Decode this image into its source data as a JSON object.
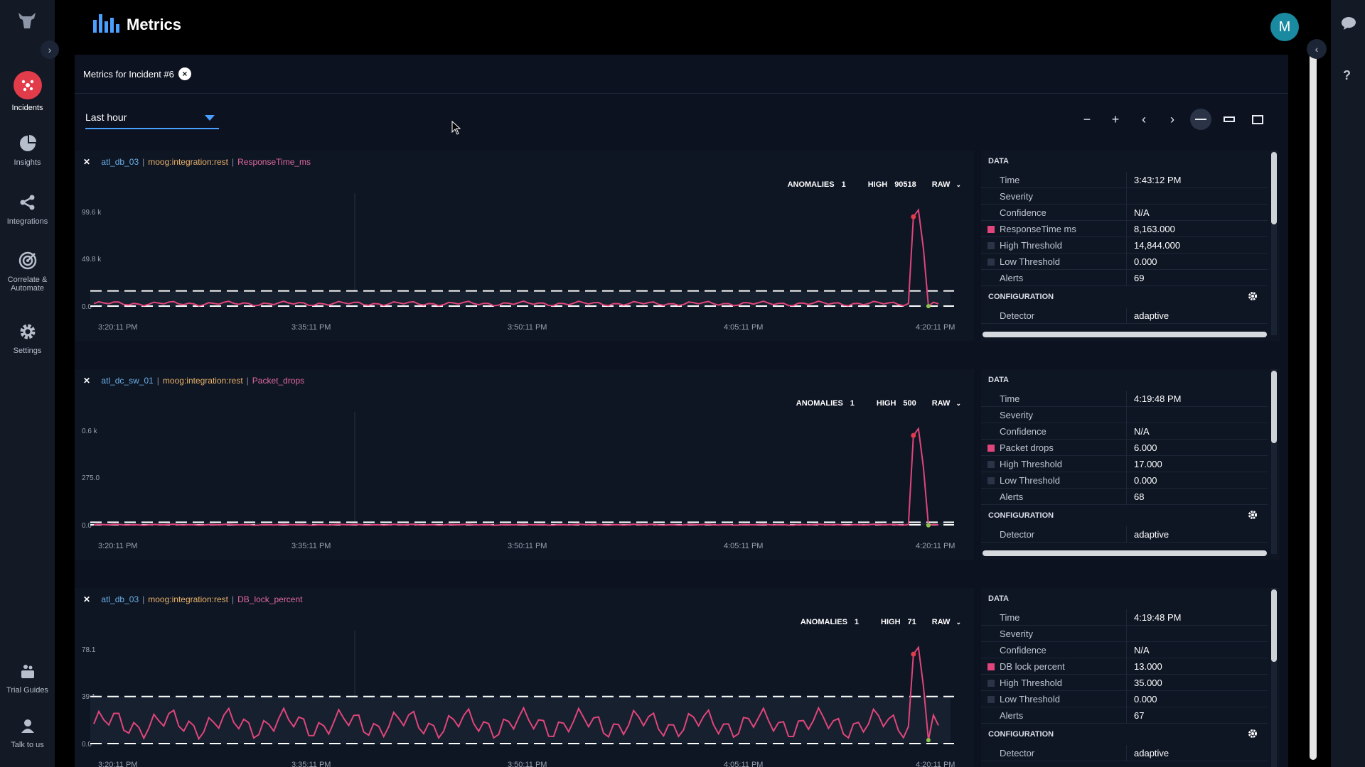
{
  "header": {
    "title": "Metrics"
  },
  "user": {
    "initial": "M"
  },
  "nav": {
    "items": [
      {
        "label": "Incidents",
        "icon": "incidents-icon"
      },
      {
        "label": "Insights",
        "icon": "insights-icon"
      },
      {
        "label": "Integrations",
        "icon": "integrations-icon"
      },
      {
        "label": "Correlate &",
        "label2": "Automate",
        "icon": "correlate-icon"
      },
      {
        "label": "Settings",
        "icon": "gear-icon"
      },
      {
        "label": "Trial Guides",
        "icon": "trial-guides-icon"
      },
      {
        "label": "Talk to us",
        "icon": "talk-icon"
      }
    ]
  },
  "panel": {
    "title": "Metrics for Incident #6",
    "time_range": "Last hour"
  },
  "toolbar": {
    "zoom_out": "−",
    "zoom_in": "+",
    "prev": "‹",
    "next": "›"
  },
  "help": "?",
  "metrics": [
    {
      "source": "atl_db_03",
      "integration": "moog:integration:rest",
      "metric": "ResponseTime_ms",
      "anomalies_label": "ANOMALIES",
      "anomalies": "1",
      "high_label": "HIGH",
      "high": "90518",
      "mode": "RAW",
      "y_ticks": [
        "99.6 k",
        "49.8 k",
        "0.0"
      ],
      "x_ticks": [
        "3:20:11 PM",
        "3:35:11 PM",
        "3:50:11 PM",
        "4:05:11 PM",
        "4:20:11 PM"
      ],
      "chart_data": {
        "type": "line",
        "ylim": [
          0,
          99600
        ],
        "high_threshold": 14844,
        "low_threshold": 0,
        "baseline": 3000,
        "noise": 2500,
        "spike_peak": 90518,
        "spike_start": 3000
      },
      "data": {
        "section": "DATA",
        "rows": [
          {
            "k": "Time",
            "v": "3:43:12 PM",
            "sw": "none"
          },
          {
            "k": "Severity",
            "v": "",
            "sw": "none"
          },
          {
            "k": "Confidence",
            "v": "N/A",
            "sw": "none"
          },
          {
            "k": "ResponseTime ms",
            "v": "8,163.000",
            "sw": "pink"
          },
          {
            "k": "High Threshold",
            "v": "14,844.000",
            "sw": "dark"
          },
          {
            "k": "Low Threshold",
            "v": "0.000",
            "sw": "dark"
          },
          {
            "k": "Alerts",
            "v": "69",
            "sw": "none"
          }
        ],
        "config": "CONFIGURATION",
        "detector_k": "Detector",
        "detector_v": "adaptive"
      }
    },
    {
      "source": "atl_dc_sw_01",
      "integration": "moog:integration:rest",
      "metric": "Packet_drops",
      "anomalies_label": "ANOMALIES",
      "anomalies": "1",
      "high_label": "HIGH",
      "high": "500",
      "mode": "RAW",
      "y_ticks": [
        "0.6 k",
        "275.0",
        "0.0"
      ],
      "x_ticks": [
        "3:20:11 PM",
        "3:35:11 PM",
        "3:50:11 PM",
        "4:05:11 PM",
        "4:20:11 PM"
      ],
      "chart_data": {
        "type": "line",
        "ylim": [
          0,
          550
        ],
        "high_threshold": 17,
        "low_threshold": 0,
        "baseline": 4,
        "noise": 3,
        "spike_peak": 500,
        "spike_start": 5
      },
      "data": {
        "section": "DATA",
        "rows": [
          {
            "k": "Time",
            "v": "4:19:48 PM",
            "sw": "none"
          },
          {
            "k": "Severity",
            "v": "",
            "sw": "none"
          },
          {
            "k": "Confidence",
            "v": "N/A",
            "sw": "none"
          },
          {
            "k": "Packet drops",
            "v": "6.000",
            "sw": "pink"
          },
          {
            "k": "High Threshold",
            "v": "17.000",
            "sw": "dark"
          },
          {
            "k": "Low Threshold",
            "v": "0.000",
            "sw": "dark"
          },
          {
            "k": "Alerts",
            "v": "68",
            "sw": "none"
          }
        ],
        "config": "CONFIGURATION",
        "detector_k": "Detector",
        "detector_v": "adaptive"
      }
    },
    {
      "source": "atl_db_03",
      "integration": "moog:integration:rest",
      "metric": "DB_lock_percent",
      "anomalies_label": "ANOMALIES",
      "anomalies": "1",
      "high_label": "HIGH",
      "high": "71",
      "mode": "RAW",
      "y_ticks": [
        "78.1",
        "39.1",
        "0.0"
      ],
      "x_ticks": [
        "3:20:11 PM",
        "3:35:11 PM",
        "3:50:11 PM",
        "4:05:11 PM",
        "4:20:11 PM"
      ],
      "chart_data": {
        "type": "line",
        "ylim": [
          0,
          78.1
        ],
        "high_threshold": 35,
        "low_threshold": 0,
        "baseline": 15,
        "noise": 13,
        "spike_peak": 71,
        "spike_start": 13
      },
      "data": {
        "section": "DATA",
        "rows": [
          {
            "k": "Time",
            "v": "4:19:48 PM",
            "sw": "none"
          },
          {
            "k": "Severity",
            "v": "",
            "sw": "none"
          },
          {
            "k": "Confidence",
            "v": "N/A",
            "sw": "none"
          },
          {
            "k": "DB lock percent",
            "v": "13.000",
            "sw": "pink"
          },
          {
            "k": "High Threshold",
            "v": "35.000",
            "sw": "dark"
          },
          {
            "k": "Low Threshold",
            "v": "0.000",
            "sw": "dark"
          },
          {
            "k": "Alerts",
            "v": "67",
            "sw": "none"
          }
        ],
        "config": "CONFIGURATION",
        "detector_k": "Detector",
        "detector_v": "adaptive"
      }
    }
  ],
  "colors": {
    "accent": "#4aa0ff",
    "series": "#e0457b",
    "incident": "#e23b4a"
  }
}
